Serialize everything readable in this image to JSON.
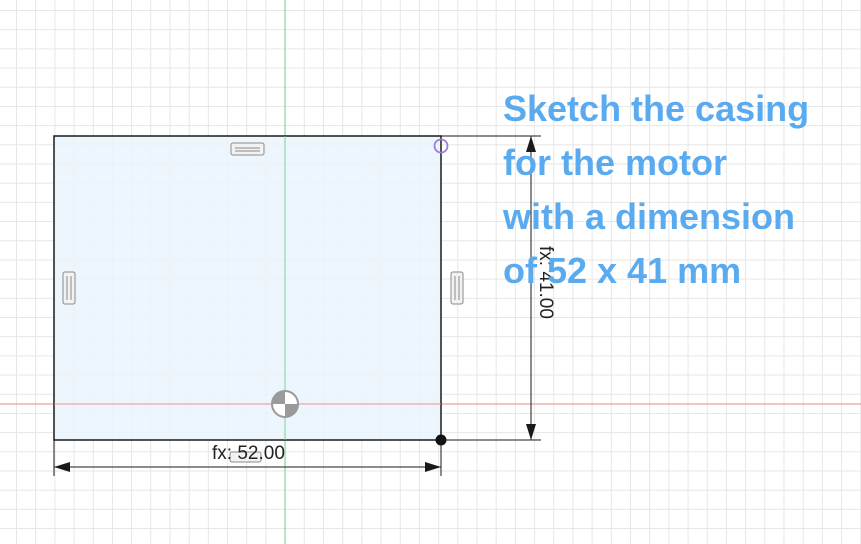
{
  "dimensions": {
    "width_label": "fx: 52.00",
    "height_label": "fx: 41.00"
  },
  "instruction": {
    "lines": [
      "Sketch the casing",
      "for the motor",
      "with a dimension",
      "of 52 x 41 mm"
    ]
  },
  "colors": {
    "grid": "#e6e6e6",
    "x_axis": "#e88a8a",
    "y_axis": "#6fcf8a",
    "profile_fill": "#eaf4fc",
    "instruction_text": "#5aaaf0"
  }
}
